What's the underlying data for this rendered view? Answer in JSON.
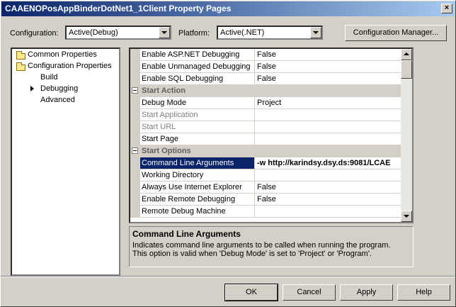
{
  "window": {
    "title": "CAAENOPosAppBinderDotNet1_1Client Property Pages",
    "close_label": "×"
  },
  "top": {
    "configuration_label": "Configuration:",
    "configuration_value": "Active(Debug)",
    "platform_label": "Platform:",
    "platform_value": "Active(.NET)",
    "config_manager_label": "Configuration Manager..."
  },
  "tree": {
    "items": [
      {
        "label": "Common Properties"
      },
      {
        "label": "Configuration Properties"
      },
      {
        "label": "Build"
      },
      {
        "label": "Debugging"
      },
      {
        "label": "Advanced"
      }
    ]
  },
  "grid": {
    "rows": [
      {
        "name": "Enable ASP.NET Debugging",
        "value": "False"
      },
      {
        "name": "Enable Unmanaged Debugging",
        "value": "False"
      },
      {
        "name": "Enable SQL Debugging",
        "value": "False"
      },
      {
        "name": "Start Action",
        "value": ""
      },
      {
        "name": "Debug Mode",
        "value": "Project"
      },
      {
        "name": "Start Application",
        "value": ""
      },
      {
        "name": "Start URL",
        "value": ""
      },
      {
        "name": "Start Page",
        "value": ""
      },
      {
        "name": "Start Options",
        "value": ""
      },
      {
        "name": "Command Line Arguments",
        "value": "-w http://karindsy.dsy.ds:9081/LCAE"
      },
      {
        "name": "Working Directory",
        "value": ""
      },
      {
        "name": "Always Use Internet Explorer",
        "value": "False"
      },
      {
        "name": "Enable Remote Debugging",
        "value": "False"
      },
      {
        "name": "Remote Debug Machine",
        "value": ""
      }
    ]
  },
  "description": {
    "title": "Command Line Arguments",
    "line1": "Indicates command line arguments to be called when running the program.",
    "line2": "This option is valid when 'Debug Mode' is set to 'Project' or 'Program'."
  },
  "buttons": {
    "ok": "OK",
    "cancel": "Cancel",
    "apply": "Apply",
    "help": "Help"
  }
}
